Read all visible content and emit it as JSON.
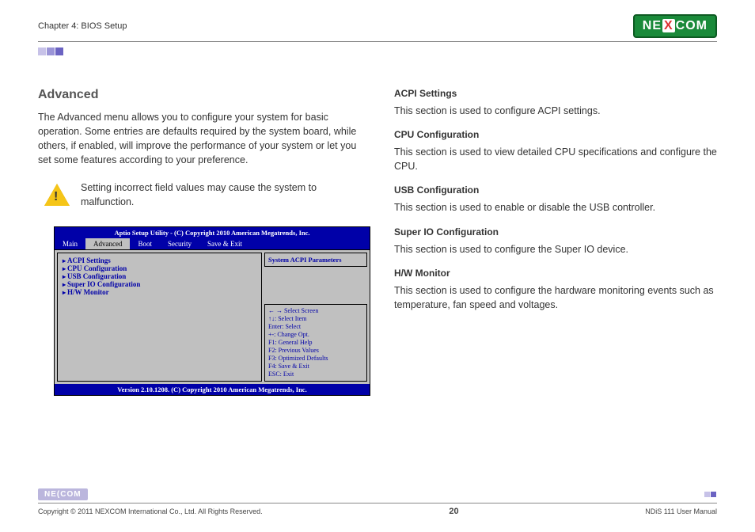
{
  "header": {
    "chapter": "Chapter 4: BIOS Setup",
    "logo_left": "NE",
    "logo_x": "X",
    "logo_right": "COM"
  },
  "left": {
    "title": "Advanced",
    "intro": "The Advanced menu allows you to configure your system for basic operation. Some entries are defaults required by the system board, while others, if enabled, will improve the performance of your system or let you set some features according to your preference.",
    "warning": "Setting incorrect field values may cause the system to malfunction."
  },
  "bios": {
    "title": "Aptio Setup Utility - (C) Copyright 2010 American Megatrends, Inc.",
    "tabs": [
      "Main",
      "Advanced",
      "Boot",
      "Security",
      "Save & Exit"
    ],
    "active_tab": "Advanced",
    "items": [
      "ACPI Settings",
      "CPU Configuration",
      "USB Configuration",
      "Super IO Configuration",
      "H/W Monitor"
    ],
    "help": "System ACPI Parameters",
    "keys": [
      "← →   Select Screen",
      "↑↓:    Select Item",
      "Enter: Select",
      "+-:    Change Opt.",
      "F1:   General Help",
      "F2:   Previous Values",
      "F3:   Optimized Defaults",
      "F4:   Save & Exit",
      "ESC: Exit"
    ],
    "footer": "Version 2.10.1208. (C) Copyright 2010 American Megatrends, Inc."
  },
  "right": {
    "sections": [
      {
        "title": "ACPI Settings",
        "body": "This section is used to configure ACPI settings."
      },
      {
        "title": "CPU Configuration",
        "body": "This section is used to view detailed CPU specifications and configure the CPU."
      },
      {
        "title": "USB Configuration",
        "body": "This section is used to enable or disable the USB controller."
      },
      {
        "title": "Super IO Configuration",
        "body": "This section is used to configure the Super IO device."
      },
      {
        "title": "H/W Monitor",
        "body": "This section is used to configure the hardware monitoring events such as temperature, fan speed and voltages."
      }
    ]
  },
  "footer": {
    "copyright": "Copyright © 2011 NEXCOM International Co., Ltd. All Rights Reserved.",
    "page": "20",
    "manual": "NDiS 111 User Manual",
    "foot_logo": "NE(COM"
  }
}
